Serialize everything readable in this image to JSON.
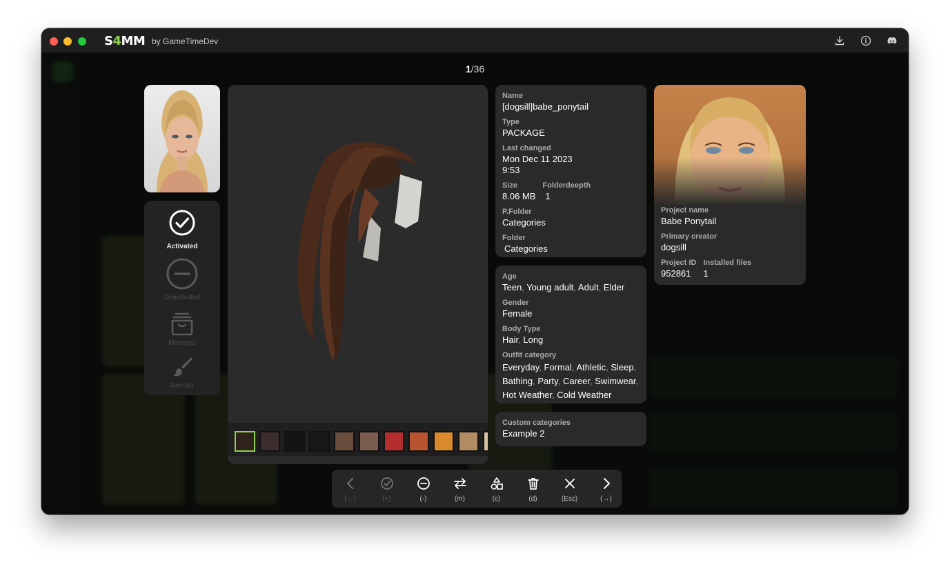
{
  "window": {
    "logo_prefix": "S",
    "logo_four": "4",
    "logo_suffix": "MM",
    "byline": "by GameTimeDev"
  },
  "titlebar_icons": [
    "download-icon",
    "info-icon",
    "discord-icon"
  ],
  "counter": {
    "current": "1",
    "total": "/36"
  },
  "status": {
    "activated": "Activated",
    "deactivated": "Deactivated",
    "merged": "Mereged",
    "recolor": "Recolor"
  },
  "swatch_colors": [
    "#2f221d",
    "#3b2d2b",
    "#141414",
    "#171717",
    "#6a4c3c",
    "#7a5d4e",
    "#b52e2e",
    "#b85430",
    "#d98a2a",
    "#b18b62",
    "#d6c2a3"
  ],
  "file_info": {
    "name_label": "Name",
    "name": "[dogsill]babe_ponytail",
    "type_label": "Type",
    "type": "PACKAGE",
    "last_changed_label": "Last changed",
    "last_changed_date": "Mon Dec 11 2023",
    "last_changed_time": "9:53",
    "size_label": "Size",
    "size": "8.06 MB",
    "folderdeepth_label": "Folderdeepth",
    "folderdeepth": "1",
    "pfolder_label": "P.Folder",
    "pfolder": "Categories",
    "folder_label": "Folder",
    "folder": "Categories"
  },
  "attributes": {
    "age_label": "Age",
    "age": [
      "Teen",
      "Young adult",
      "Adult",
      "Elder"
    ],
    "gender_label": "Gender",
    "gender": "Female",
    "body_type_label": "Body Type",
    "body_type": [
      "Hair",
      "Long"
    ],
    "outfit_label": "Outfit category",
    "outfit_row1": [
      "Everyday",
      "Formal",
      "Athletic",
      "Sleep"
    ],
    "outfit_row2": [
      "Bathing",
      "Party",
      "Career",
      "Swimwear"
    ],
    "outfit_row3": [
      "Hot Weather",
      "Cold Weather"
    ]
  },
  "custom": {
    "label": "Custom categories",
    "value": "Example 2"
  },
  "project": {
    "name_label": "Project name",
    "name": "Babe Ponytail",
    "creator_label": "Primary creator",
    "creator": "dogsill",
    "id_label": "Project ID",
    "id": "952861",
    "installed_label": "Installed files",
    "installed": "1"
  },
  "toolbar": {
    "prev_key": "(←)",
    "activate_key": "(+)",
    "deactivate_key": "(-)",
    "move_key": "(m)",
    "categories_key": "(c)",
    "delete_key": "(d)",
    "close_key": "(Esc)",
    "next_key": "(→)"
  }
}
